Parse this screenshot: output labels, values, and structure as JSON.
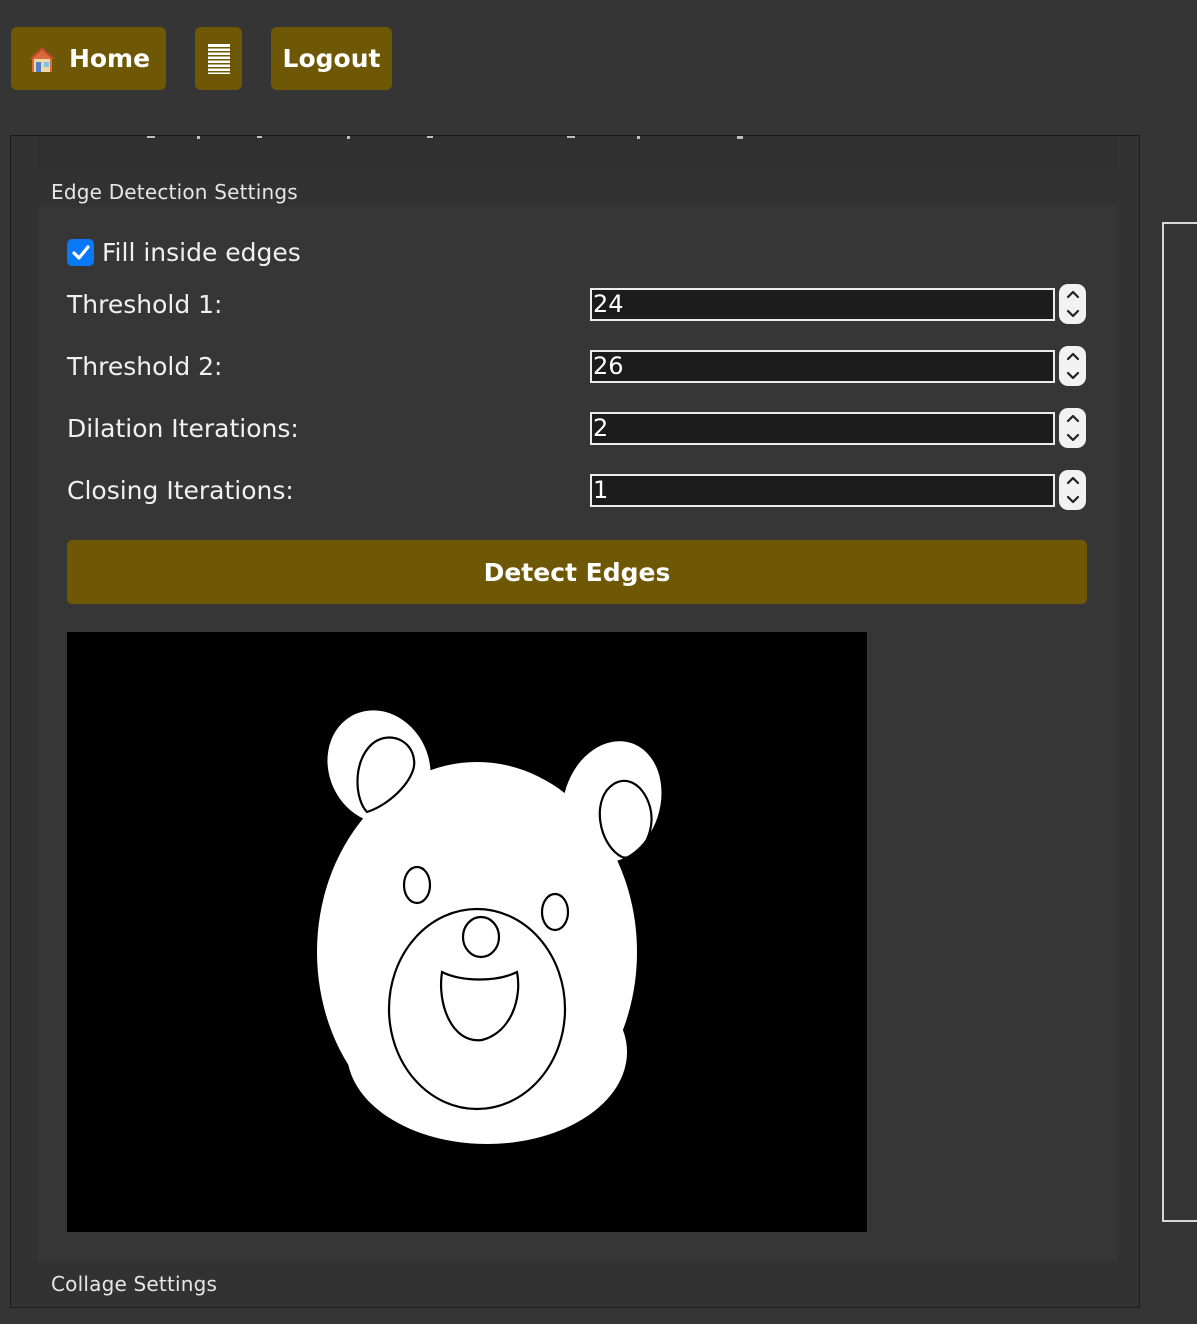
{
  "topbar": {
    "home_label": "Home",
    "logout_label": "Logout"
  },
  "edge_detection": {
    "title": "Edge Detection Settings",
    "fill_inside_label": "Fill inside edges",
    "fill_inside_checked": true,
    "fields": [
      {
        "label": "Threshold 1:",
        "value": "24"
      },
      {
        "label": "Threshold 2:",
        "value": "26"
      },
      {
        "label": "Dilation Iterations:",
        "value": "2"
      },
      {
        "label": "Closing Iterations:",
        "value": "1"
      }
    ],
    "detect_button_label": "Detect Edges"
  },
  "collage": {
    "title": "Collage Settings"
  },
  "colors": {
    "accent": "#6e5705",
    "checkbox": "#0a79f7",
    "background": "#353535"
  },
  "icons": {
    "home": "house-icon",
    "menu": "menu-lines-icon",
    "stepper_up": "chevron-up-icon",
    "stepper_down": "chevron-down-icon",
    "check": "checkmark-icon"
  }
}
